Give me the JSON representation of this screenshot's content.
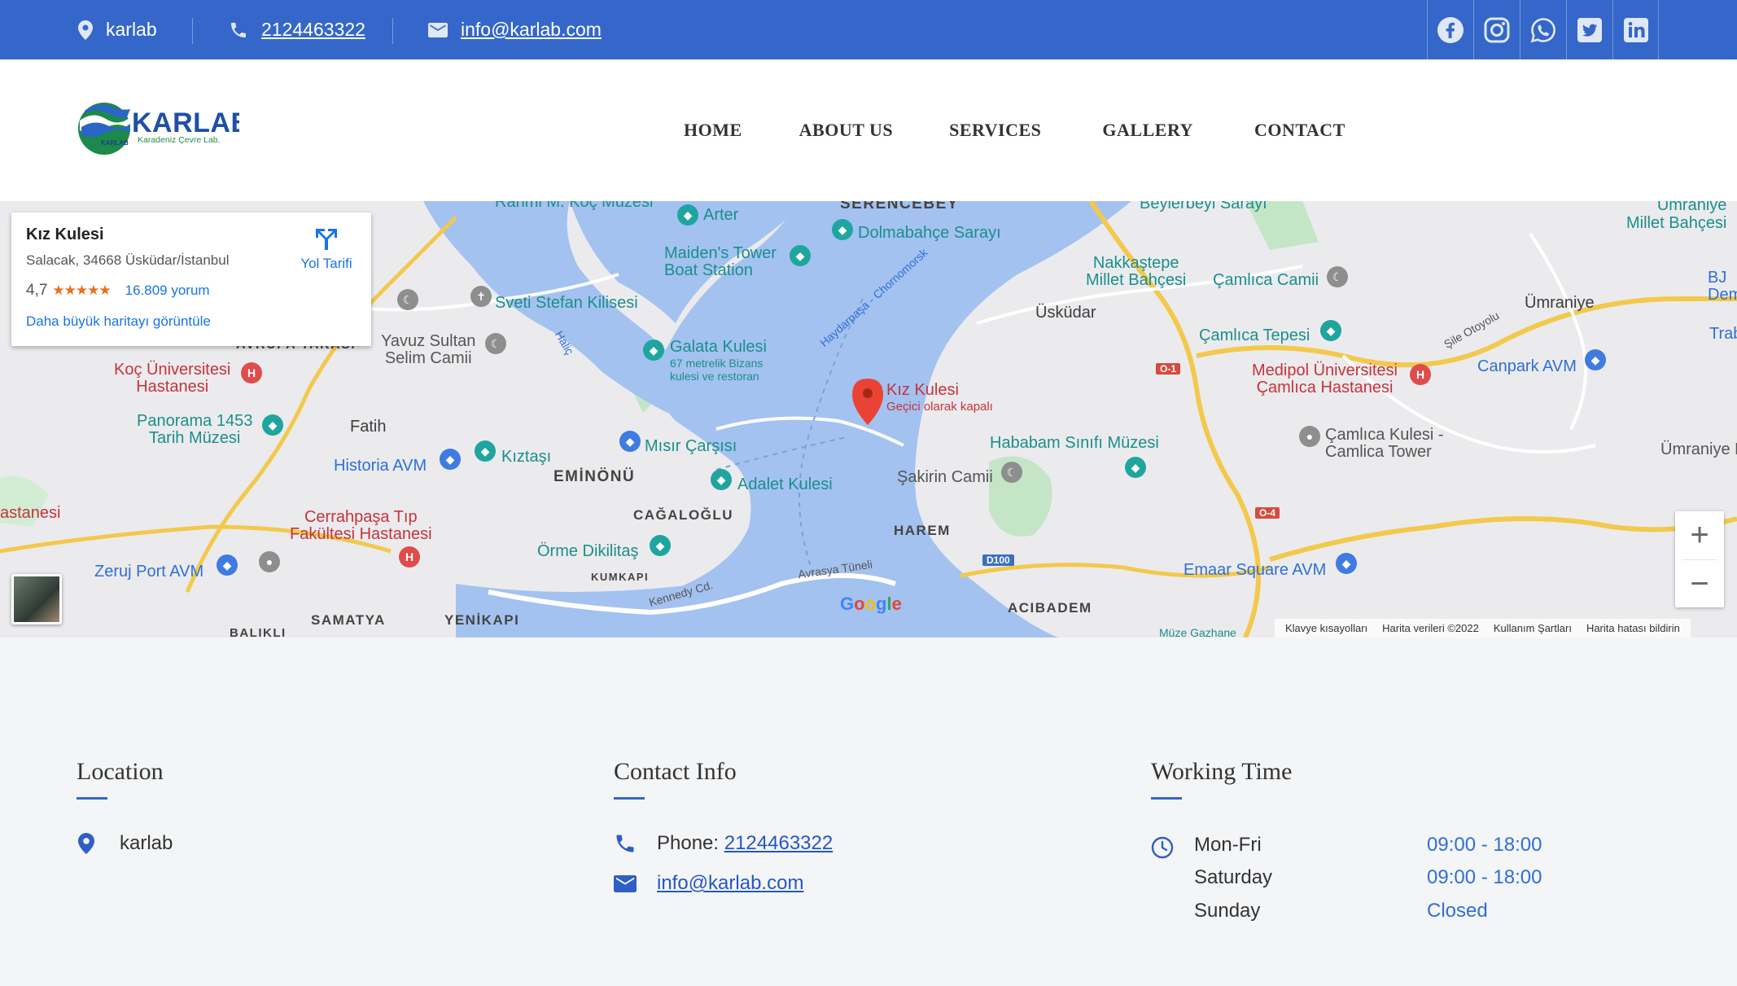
{
  "topbar": {
    "location": "karlab",
    "phone": "2124463322",
    "email": "info@karlab.com",
    "social": [
      {
        "icon": "facebook-icon"
      },
      {
        "icon": "instagram-icon"
      },
      {
        "icon": "whatsapp-icon"
      },
      {
        "icon": "twitter-icon"
      },
      {
        "icon": "linkedin-icon"
      }
    ],
    "accent": "#3467c9"
  },
  "header": {
    "logo_text": "KARLAB",
    "logo_sub": "Karadeniz Çevre Lab.",
    "logo_badge": "KARLAB",
    "nav": [
      "HOME",
      "ABOUT US",
      "SERVICES",
      "GALLERY",
      "CONTACT"
    ]
  },
  "map": {
    "infocard": {
      "title": "Kız Kulesi",
      "address": "Salacak, 34668 Üsküdar/İstanbul",
      "rating": "4,7",
      "stars": "★★★★★",
      "reviews": "16.809 yorum",
      "larger_map": "Daha büyük haritayı görüntüle",
      "directions": "Yol Tarifi"
    },
    "marker": {
      "title": "Kız Kulesi",
      "subtitle": "Geçici olarak kapalı"
    },
    "labels": {
      "rahmi": "Rahmi M. Koç Müzesi",
      "arter": "Arter",
      "serencebey": "SERENCEBEY",
      "dolmabahce": "Dolmabahçe Sarayı",
      "beylerbeyi": "Beylerbeyi Sarayı",
      "umraniye_park": "Ümraniye\nMillet Bahçesi",
      "maidens": "Maiden's Tower\nBoat Station",
      "nakkastepe": "Nakkaştepe\nMillet Bahçesi",
      "camlica_camii": "Çamlıca Camii",
      "umraniye": "Ümraniye",
      "sveti": "Sveti Stefan Kilisesi",
      "uskudar": "Üsküdar",
      "camlica_tepesi": "Çamlıca Tepesi",
      "canpark": "Canpark AVM",
      "avrupa": "AVRUPA YAKASI",
      "yavuz": "Yavuz Sultan\nSelim Camii",
      "galata": "Galata Kulesi",
      "galata_sub": "67 metrelik Bizans\nkulesi ve restoran",
      "medipol": "Medipol Üniversitesi\nÇamlıca Hastanesi",
      "koc": "Koç Üniversitesi\nHastanesi",
      "panorama": "Panorama 1453\nTarih Müzesi",
      "fatih": "Fatih",
      "camlica_kulesi": "Çamlıca Kulesi -\nCamlica Tower",
      "hababam": "Hababam Sınıfı Müzesi",
      "historia": "Historia AVM",
      "kiztasi": "Kıztaşı",
      "misir": "Mısır Çarşısı",
      "eminonu": "EMİNÖNÜ",
      "adalet": "Adalet Kulesi",
      "sakirin": "Şakirin Camii",
      "cagaloglu": "CAĞALOĞLU",
      "hastanesi": "astanesi",
      "cerrahpasa": "Cerrahpaşa Tıp\nFakültesi Hastanesi",
      "orme": "Örme Dikilitaş",
      "harem": "HAREM",
      "emaar": "Emaar Square AVM",
      "zeruj": "Zeruj Port AVM",
      "kumkapi": "KUMKAPI",
      "avrasya": "Avrasya Tüneli",
      "kennedy": "Kennedy Cd.",
      "samatya": "SAMATYA",
      "yenikapi": "YENİKAPI",
      "acibadem": "ACIBADEM",
      "haydarpasa": "Haydarpaşa - Chornomorsk",
      "halic": "Haliç",
      "sile": "Şile Otoyolu",
      "umraniye_n": "Ümraniye N",
      "bj": "BJ\nDemir",
      "trab": "Trab",
      "muze": "Müze Gazhane",
      "balikli": "BALIKLI",
      "highway_d100": "D100",
      "highway_o1": "O-1",
      "highway_o4": "O-4"
    },
    "google": "Google",
    "attribution": [
      "Klavye kısayolları",
      "Harita verileri ©2022",
      "Kullanım Şartları",
      "Harita hatası bildirin"
    ],
    "zoom_in": "+",
    "zoom_out": "−"
  },
  "footer": {
    "location": {
      "heading": "Location",
      "value": "karlab"
    },
    "contact": {
      "heading": "Contact Info",
      "phone_label": "Phone: ",
      "phone": "2124463322",
      "email": "info@karlab.com"
    },
    "working": {
      "heading": "Working Time",
      "rows": [
        {
          "day": "Mon-Fri",
          "time": "09:00 - 18:00"
        },
        {
          "day": "Saturday",
          "time": "09:00 - 18:00"
        },
        {
          "day": "Sunday",
          "time": "Closed"
        }
      ]
    }
  }
}
